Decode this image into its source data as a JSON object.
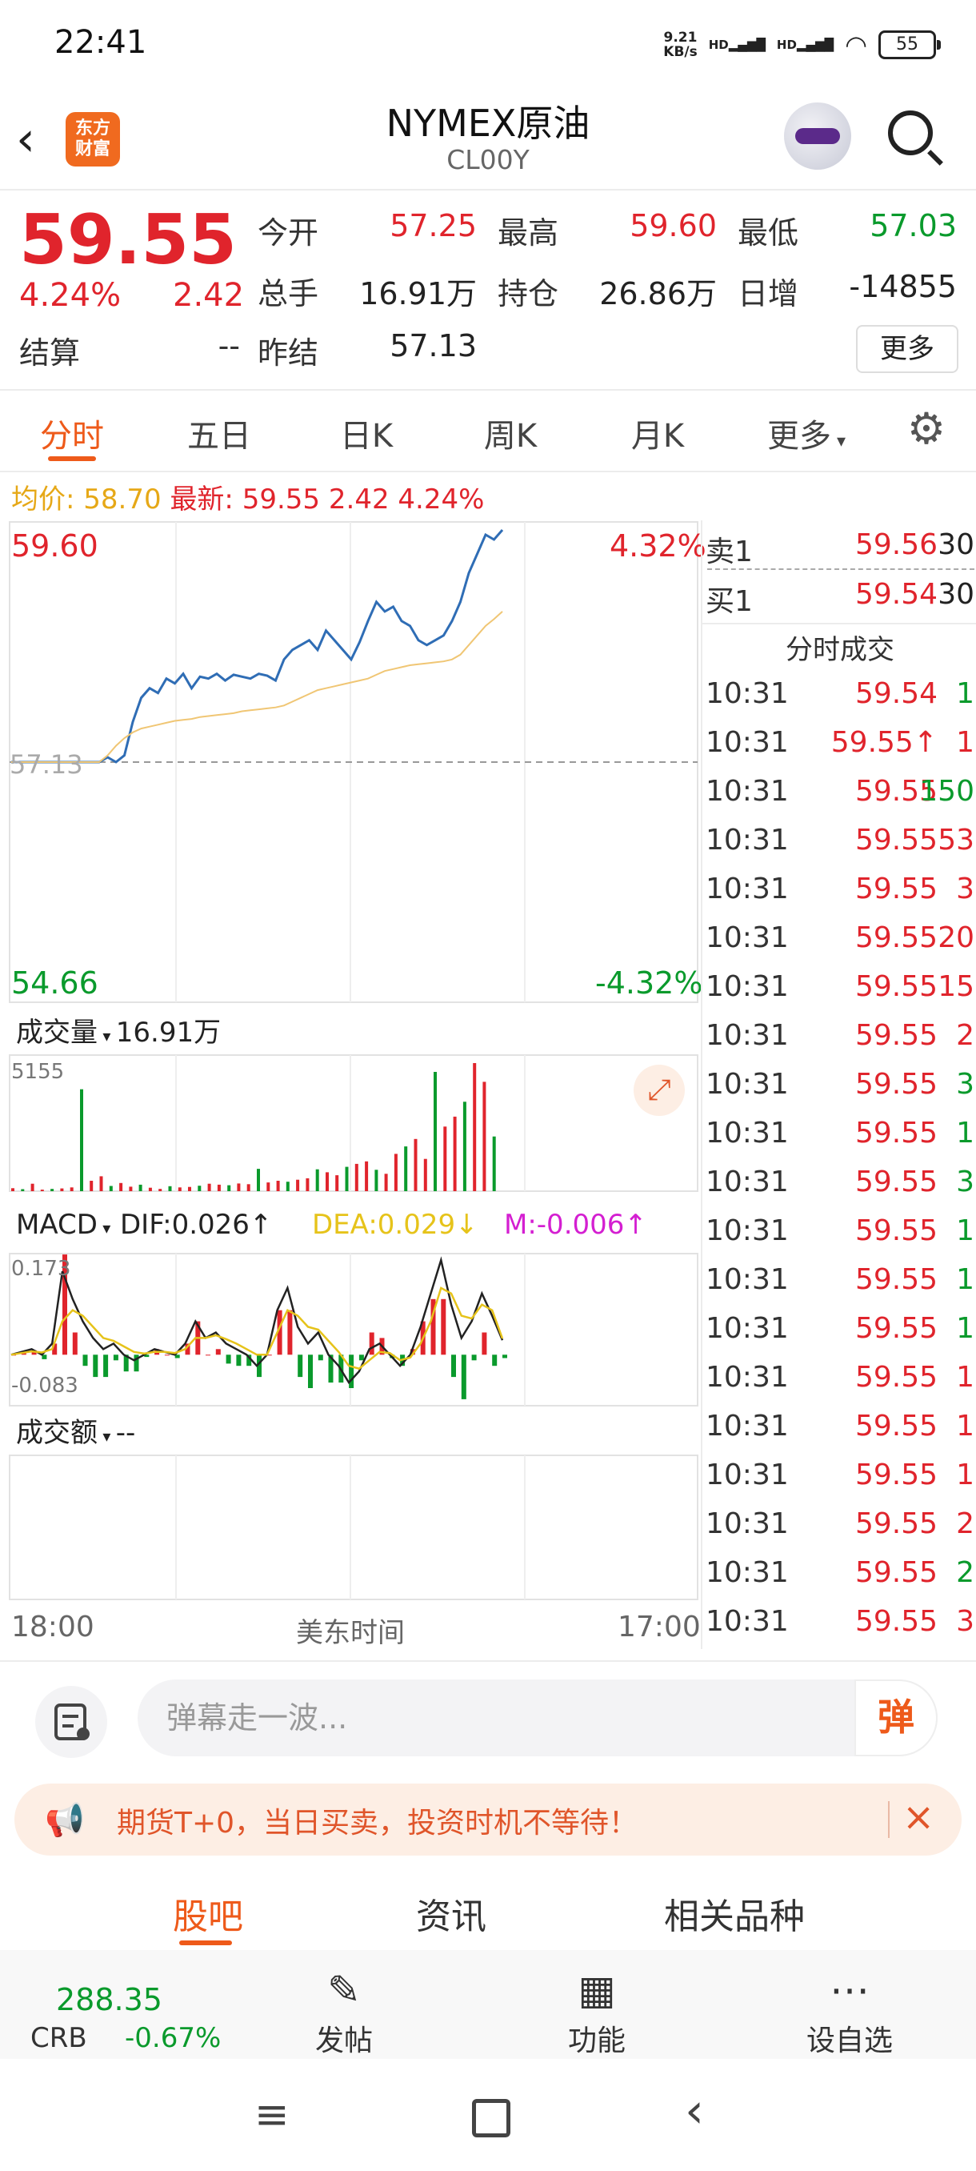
{
  "status_bar": {
    "time": "22:41",
    "net_speed_top": "9.21",
    "net_speed_bottom": "KB/s",
    "sim1": "HD",
    "sim2": "HD",
    "battery": "55"
  },
  "header": {
    "title": "NYMEX原油",
    "subtitle": "CL00Y",
    "logo_line1": "东方",
    "logo_line2": "财富"
  },
  "quote": {
    "price": "59.55",
    "change_pct": "4.24%",
    "change": "2.42",
    "settle_label": "结算",
    "settle_value": "--",
    "fields": [
      {
        "label": "今开",
        "value": "57.25",
        "color": "red"
      },
      {
        "label": "最高",
        "value": "59.60",
        "color": "red"
      },
      {
        "label": "最低",
        "value": "57.03",
        "color": "green"
      },
      {
        "label": "总手",
        "value": "16.91万",
        "color": "black"
      },
      {
        "label": "持仓",
        "value": "26.86万",
        "color": "black"
      },
      {
        "label": "日增",
        "value": "-14855",
        "color": "black"
      },
      {
        "label": "昨结",
        "value": "57.13",
        "color": "black"
      }
    ],
    "more_button": "更多"
  },
  "tabs": {
    "items": [
      "分时",
      "五日",
      "日K",
      "周K",
      "月K",
      "更多"
    ],
    "active": 0
  },
  "info_line": {
    "avg_label": "均价:",
    "avg_value": "58.70",
    "latest_label": "最新:",
    "latest_value": "59.55",
    "change": "2.42",
    "change_pct": "4.24%"
  },
  "chart_data": [
    {
      "type": "line",
      "title": "",
      "ylim": [
        54.66,
        59.6
      ],
      "y_top_label": "59.60",
      "y_bottom_label": "54.66",
      "pct_top_label": "4.32%",
      "pct_bottom_label": "-4.32%",
      "ref_label": "57.13",
      "x_labels": [
        "18:00",
        "美东时间",
        "17:00"
      ],
      "series": [
        {
          "name": "最新",
          "color": "#2f6db5",
          "values": [
            57.13,
            57.18,
            57.13,
            57.2,
            57.55,
            57.8,
            57.9,
            57.85,
            58.0,
            57.95,
            58.05,
            57.9,
            58.02,
            58.0,
            58.05,
            57.98,
            58.04,
            58.02,
            58.0,
            58.05,
            58.03,
            57.98,
            58.2,
            58.3,
            58.35,
            58.4,
            58.3,
            58.5,
            58.4,
            58.3,
            58.2,
            58.38,
            58.6,
            58.8,
            58.7,
            58.75,
            58.6,
            58.55,
            58.4,
            58.35,
            58.4,
            58.45,
            58.6,
            58.8,
            59.1,
            59.3,
            59.5,
            59.45,
            59.55
          ]
        },
        {
          "name": "均价",
          "color": "#f0c674",
          "values": [
            57.13,
            57.2,
            57.3,
            57.38,
            57.44,
            57.48,
            57.5,
            57.52,
            57.54,
            57.56,
            57.57,
            57.58,
            57.6,
            57.61,
            57.62,
            57.63,
            57.64,
            57.66,
            57.67,
            57.68,
            57.69,
            57.7,
            57.72,
            57.76,
            57.8,
            57.84,
            57.88,
            57.9,
            57.92,
            57.94,
            57.96,
            57.98,
            58.0,
            58.04,
            58.08,
            58.1,
            58.12,
            58.14,
            58.15,
            58.16,
            58.17,
            58.18,
            58.2,
            58.25,
            58.35,
            58.45,
            58.55,
            58.62,
            58.7
          ]
        }
      ]
    },
    {
      "type": "bar",
      "title": "成交量",
      "value_label": "16.91万",
      "y_max_label": "5155",
      "values": [
        120,
        80,
        300,
        60,
        90,
        110,
        150,
        4100,
        420,
        600,
        210,
        330,
        180,
        260,
        140,
        90,
        200,
        150,
        170,
        220,
        300,
        260,
        240,
        310,
        280,
        900,
        350,
        420,
        380,
        460,
        520,
        880,
        760,
        640,
        980,
        1100,
        1200,
        860,
        700,
        1500,
        1800,
        2100,
        1300,
        4800,
        2600,
        3000,
        3600,
        5155,
        4400,
        2200
      ],
      "colors": [
        "red",
        "green"
      ]
    },
    {
      "type": "line",
      "title": "MACD",
      "dif_label": "DIF:0.026",
      "dea_label": "DEA:0.029",
      "m_label": "M:-0.006",
      "y_top_label": "0.173",
      "y_bottom_label": "-0.083",
      "ylim": [
        -0.083,
        0.173
      ],
      "series": [
        {
          "name": "DIF",
          "color": "#222222",
          "values": [
            0.0,
            0.005,
            0.01,
            0.0,
            0.02,
            0.15,
            0.1,
            0.06,
            0.03,
            0.01,
            0.02,
            0.0,
            -0.01,
            0.0,
            0.01,
            0.005,
            0.0,
            0.02,
            0.06,
            0.03,
            0.04,
            0.02,
            0.01,
            0.0,
            -0.02,
            0.0,
            0.08,
            0.12,
            0.05,
            0.02,
            0.04,
            0.0,
            -0.02,
            -0.05,
            -0.03,
            0.01,
            0.02,
            0.0,
            -0.02,
            0.0,
            0.05,
            0.11,
            0.17,
            0.09,
            0.03,
            0.06,
            0.11,
            0.07,
            0.026
          ]
        },
        {
          "name": "DEA",
          "color": "#e6c31a",
          "values": [
            0.0,
            0.003,
            0.006,
            0.004,
            0.01,
            0.06,
            0.08,
            0.07,
            0.05,
            0.03,
            0.025,
            0.015,
            0.005,
            0.002,
            0.005,
            0.005,
            0.003,
            0.01,
            0.03,
            0.03,
            0.035,
            0.028,
            0.02,
            0.01,
            0.0,
            0.0,
            0.04,
            0.08,
            0.07,
            0.05,
            0.045,
            0.025,
            0.005,
            -0.02,
            -0.025,
            -0.01,
            0.005,
            0.003,
            -0.01,
            -0.005,
            0.02,
            0.06,
            0.12,
            0.11,
            0.07,
            0.065,
            0.09,
            0.08,
            0.029
          ]
        }
      ],
      "bars": [
        0.0,
        0.004,
        0.008,
        -0.008,
        0.02,
        0.18,
        0.04,
        -0.02,
        -0.04,
        -0.04,
        -0.01,
        -0.03,
        -0.03,
        -0.004,
        0.01,
        0.0,
        -0.006,
        0.02,
        0.06,
        0.0,
        0.01,
        -0.016,
        -0.02,
        -0.02,
        -0.04,
        0.0,
        0.08,
        0.08,
        -0.04,
        -0.06,
        -0.01,
        -0.05,
        -0.05,
        -0.06,
        -0.01,
        0.04,
        0.03,
        -0.006,
        -0.02,
        0.01,
        0.06,
        0.1,
        0.1,
        -0.04,
        -0.08,
        -0.01,
        0.04,
        -0.02,
        -0.006
      ]
    },
    {
      "type": "bar",
      "title": "成交额",
      "value_label": "--",
      "values": []
    }
  ],
  "chart_labels": {
    "fullscreen_icon": "expand-icon"
  },
  "trades": {
    "ask_label": "卖1",
    "ask_price": "59.56",
    "ask_vol": "30",
    "bid_label": "买1",
    "bid_price": "59.54",
    "bid_vol": "30",
    "section_title": "分时成交",
    "rows": [
      {
        "time": "10:31",
        "price": "59.54",
        "vol": "1",
        "vcolor": "green"
      },
      {
        "time": "10:31",
        "price": "59.55↑",
        "vol": "1",
        "vcolor": "red"
      },
      {
        "time": "10:31",
        "price": "59.55",
        "vol": "150",
        "vcolor": "green"
      },
      {
        "time": "10:31",
        "price": "59.55",
        "vol": "53",
        "vcolor": "red"
      },
      {
        "time": "10:31",
        "price": "59.55",
        "vol": "3",
        "vcolor": "red"
      },
      {
        "time": "10:31",
        "price": "59.55",
        "vol": "20",
        "vcolor": "red"
      },
      {
        "time": "10:31",
        "price": "59.55",
        "vol": "15",
        "vcolor": "red"
      },
      {
        "time": "10:31",
        "price": "59.55",
        "vol": "2",
        "vcolor": "red"
      },
      {
        "time": "10:31",
        "price": "59.55",
        "vol": "3",
        "vcolor": "green"
      },
      {
        "time": "10:31",
        "price": "59.55",
        "vol": "1",
        "vcolor": "green"
      },
      {
        "time": "10:31",
        "price": "59.55",
        "vol": "3",
        "vcolor": "green"
      },
      {
        "time": "10:31",
        "price": "59.55",
        "vol": "1",
        "vcolor": "green"
      },
      {
        "time": "10:31",
        "price": "59.55",
        "vol": "1",
        "vcolor": "green"
      },
      {
        "time": "10:31",
        "price": "59.55",
        "vol": "1",
        "vcolor": "green"
      },
      {
        "time": "10:31",
        "price": "59.55",
        "vol": "1",
        "vcolor": "red"
      },
      {
        "time": "10:31",
        "price": "59.55",
        "vol": "1",
        "vcolor": "red"
      },
      {
        "time": "10:31",
        "price": "59.55",
        "vol": "1",
        "vcolor": "red"
      },
      {
        "time": "10:31",
        "price": "59.55",
        "vol": "2",
        "vcolor": "red"
      },
      {
        "time": "10:31",
        "price": "59.55",
        "vol": "2",
        "vcolor": "green"
      },
      {
        "time": "10:31",
        "price": "59.55",
        "vol": "3",
        "vcolor": "red"
      }
    ]
  },
  "comment_bar": {
    "placeholder": "弹幕走一波...",
    "dan_button": "弹"
  },
  "promo": {
    "text": "期货T+0，当日买卖，投资时机不等待！"
  },
  "section_tabs": {
    "items": [
      "股吧",
      "资讯",
      "相关品种"
    ],
    "active": 0
  },
  "bottom_bar": {
    "index_value": "288.35",
    "index_name": "CRB",
    "index_change": "-0.67%",
    "items": [
      "发帖",
      "功能",
      "设自选"
    ]
  },
  "colors": {
    "accent": "#ee5a1a",
    "up": "#e0242c",
    "down": "#0a9a2c",
    "line": "#2f6db5",
    "avg": "#f0c674"
  }
}
